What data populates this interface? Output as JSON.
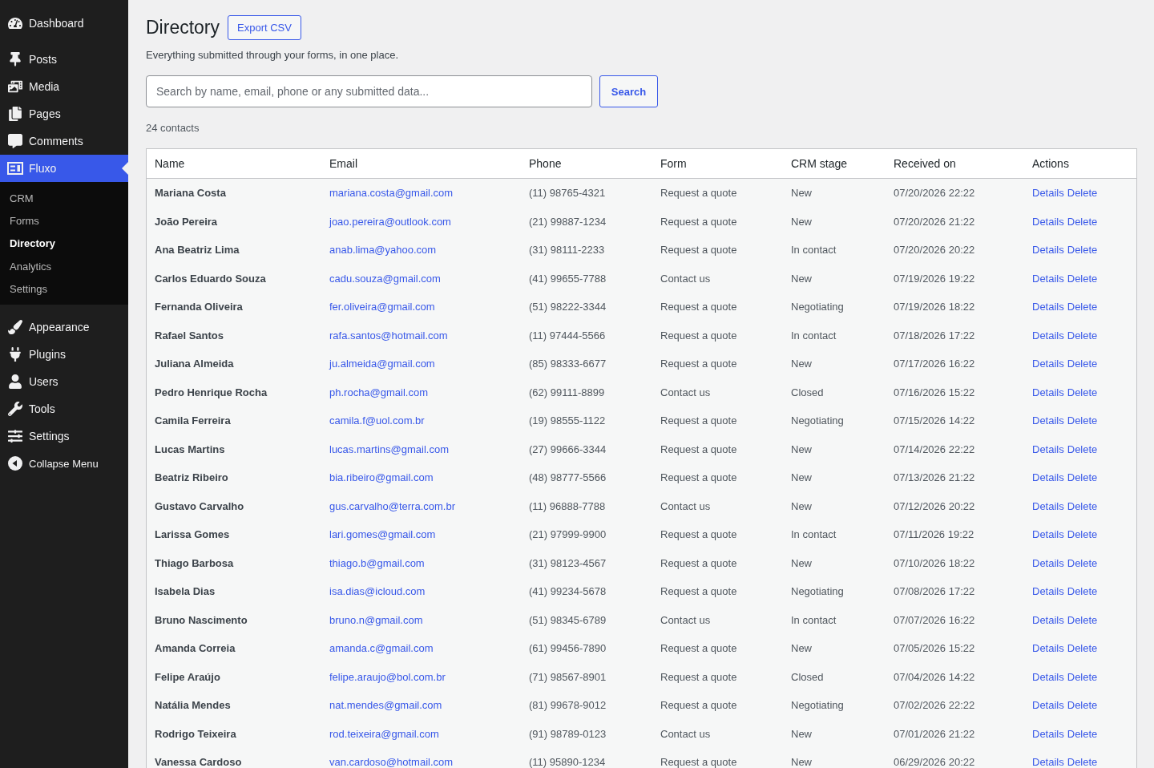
{
  "sidebar": {
    "groups": [
      {
        "items": [
          {
            "label": "Dashboard",
            "selected": false
          }
        ]
      },
      {
        "items": [
          {
            "label": "Posts",
            "selected": false
          },
          {
            "label": "Media",
            "selected": false
          },
          {
            "label": "Pages",
            "selected": false
          },
          {
            "label": "Comments",
            "selected": false
          },
          {
            "label": "Fluxo",
            "selected": true,
            "submenu": [
              {
                "label": "CRM",
                "selected": false
              },
              {
                "label": "Forms",
                "selected": false
              },
              {
                "label": "Directory",
                "selected": true
              },
              {
                "label": "Analytics",
                "selected": false
              },
              {
                "label": "Settings",
                "selected": false
              }
            ]
          }
        ]
      },
      {
        "items": [
          {
            "label": "Appearance",
            "selected": false
          },
          {
            "label": "Plugins",
            "selected": false
          },
          {
            "label": "Users",
            "selected": false
          },
          {
            "label": "Tools",
            "selected": false
          },
          {
            "label": "Settings",
            "selected": false
          }
        ]
      }
    ],
    "collapse_label": "Collapse Menu"
  },
  "page": {
    "title": "Directory",
    "export_button": "Export CSV",
    "description": "Everything submitted through your forms, in one place.",
    "search": {
      "placeholder": "Search by name, email, phone or any submitted data...",
      "button": "Search"
    },
    "count": "24 contacts"
  },
  "table": {
    "columns": [
      "Name",
      "Email",
      "Phone",
      "Form",
      "CRM stage",
      "Received on",
      "Actions"
    ],
    "rows": [
      {
        "name": "Mariana Costa",
        "email": "mariana.costa@gmail.com",
        "phone": "(11) 98765-4321",
        "form": "Request a quote",
        "stage": "New",
        "received": "07/20/2026 22:22",
        "actions": [
          "Details",
          "Delete"
        ]
      },
      {
        "name": "João Pereira",
        "email": "joao.pereira@outlook.com",
        "phone": "(21) 99887-1234",
        "form": "Request a quote",
        "stage": "New",
        "received": "07/20/2026 21:22",
        "actions": [
          "Details",
          "Delete"
        ]
      },
      {
        "name": "Ana Beatriz Lima",
        "email": "anab.lima@yahoo.com",
        "phone": "(31) 98111-2233",
        "form": "Request a quote",
        "stage": "In contact",
        "received": "07/20/2026 20:22",
        "actions": [
          "Details",
          "Delete"
        ]
      },
      {
        "name": "Carlos Eduardo Souza",
        "email": "cadu.souza@gmail.com",
        "phone": "(41) 99655-7788",
        "form": "Contact us",
        "stage": "New",
        "received": "07/19/2026 19:22",
        "actions": [
          "Details",
          "Delete"
        ]
      },
      {
        "name": "Fernanda Oliveira",
        "email": "fer.oliveira@gmail.com",
        "phone": "(51) 98222-3344",
        "form": "Request a quote",
        "stage": "Negotiating",
        "received": "07/19/2026 18:22",
        "actions": [
          "Details",
          "Delete"
        ]
      },
      {
        "name": "Rafael Santos",
        "email": "rafa.santos@hotmail.com",
        "phone": "(11) 97444-5566",
        "form": "Request a quote",
        "stage": "In contact",
        "received": "07/18/2026 17:22",
        "actions": [
          "Details",
          "Delete"
        ]
      },
      {
        "name": "Juliana Almeida",
        "email": "ju.almeida@gmail.com",
        "phone": "(85) 98333-6677",
        "form": "Request a quote",
        "stage": "New",
        "received": "07/17/2026 16:22",
        "actions": [
          "Details",
          "Delete"
        ]
      },
      {
        "name": "Pedro Henrique Rocha",
        "email": "ph.rocha@gmail.com",
        "phone": "(62) 99111-8899",
        "form": "Contact us",
        "stage": "Closed",
        "received": "07/16/2026 15:22",
        "actions": [
          "Details",
          "Delete"
        ]
      },
      {
        "name": "Camila Ferreira",
        "email": "camila.f@uol.com.br",
        "phone": "(19) 98555-1122",
        "form": "Request a quote",
        "stage": "Negotiating",
        "received": "07/15/2026 14:22",
        "actions": [
          "Details",
          "Delete"
        ]
      },
      {
        "name": "Lucas Martins",
        "email": "lucas.martins@gmail.com",
        "phone": "(27) 99666-3344",
        "form": "Request a quote",
        "stage": "New",
        "received": "07/14/2026 22:22",
        "actions": [
          "Details",
          "Delete"
        ]
      },
      {
        "name": "Beatriz Ribeiro",
        "email": "bia.ribeiro@gmail.com",
        "phone": "(48) 98777-5566",
        "form": "Request a quote",
        "stage": "New",
        "received": "07/13/2026 21:22",
        "actions": [
          "Details",
          "Delete"
        ]
      },
      {
        "name": "Gustavo Carvalho",
        "email": "gus.carvalho@terra.com.br",
        "phone": "(11) 96888-7788",
        "form": "Contact us",
        "stage": "New",
        "received": "07/12/2026 20:22",
        "actions": [
          "Details",
          "Delete"
        ]
      },
      {
        "name": "Larissa Gomes",
        "email": "lari.gomes@gmail.com",
        "phone": "(21) 97999-9900",
        "form": "Request a quote",
        "stage": "In contact",
        "received": "07/11/2026 19:22",
        "actions": [
          "Details",
          "Delete"
        ]
      },
      {
        "name": "Thiago Barbosa",
        "email": "thiago.b@gmail.com",
        "phone": "(31) 98123-4567",
        "form": "Request a quote",
        "stage": "New",
        "received": "07/10/2026 18:22",
        "actions": [
          "Details",
          "Delete"
        ]
      },
      {
        "name": "Isabela Dias",
        "email": "isa.dias@icloud.com",
        "phone": "(41) 99234-5678",
        "form": "Request a quote",
        "stage": "Negotiating",
        "received": "07/08/2026 17:22",
        "actions": [
          "Details",
          "Delete"
        ]
      },
      {
        "name": "Bruno Nascimento",
        "email": "bruno.n@gmail.com",
        "phone": "(51) 98345-6789",
        "form": "Contact us",
        "stage": "In contact",
        "received": "07/07/2026 16:22",
        "actions": [
          "Details",
          "Delete"
        ]
      },
      {
        "name": "Amanda Correia",
        "email": "amanda.c@gmail.com",
        "phone": "(61) 99456-7890",
        "form": "Request a quote",
        "stage": "New",
        "received": "07/05/2026 15:22",
        "actions": [
          "Details",
          "Delete"
        ]
      },
      {
        "name": "Felipe Araújo",
        "email": "felipe.araujo@bol.com.br",
        "phone": "(71) 98567-8901",
        "form": "Request a quote",
        "stage": "Closed",
        "received": "07/04/2026 14:22",
        "actions": [
          "Details",
          "Delete"
        ]
      },
      {
        "name": "Natália Mendes",
        "email": "nat.mendes@gmail.com",
        "phone": "(81) 99678-9012",
        "form": "Request a quote",
        "stage": "Negotiating",
        "received": "07/02/2026 22:22",
        "actions": [
          "Details",
          "Delete"
        ]
      },
      {
        "name": "Rodrigo Teixeira",
        "email": "rod.teixeira@gmail.com",
        "phone": "(91) 98789-0123",
        "form": "Contact us",
        "stage": "New",
        "received": "07/01/2026 21:22",
        "actions": [
          "Details",
          "Delete"
        ]
      },
      {
        "name": "Vanessa Cardoso",
        "email": "van.cardoso@hotmail.com",
        "phone": "(11) 95890-1234",
        "form": "Request a quote",
        "stage": "New",
        "received": "06/29/2026 20:22",
        "actions": [
          "Details",
          "Delete"
        ]
      }
    ]
  }
}
